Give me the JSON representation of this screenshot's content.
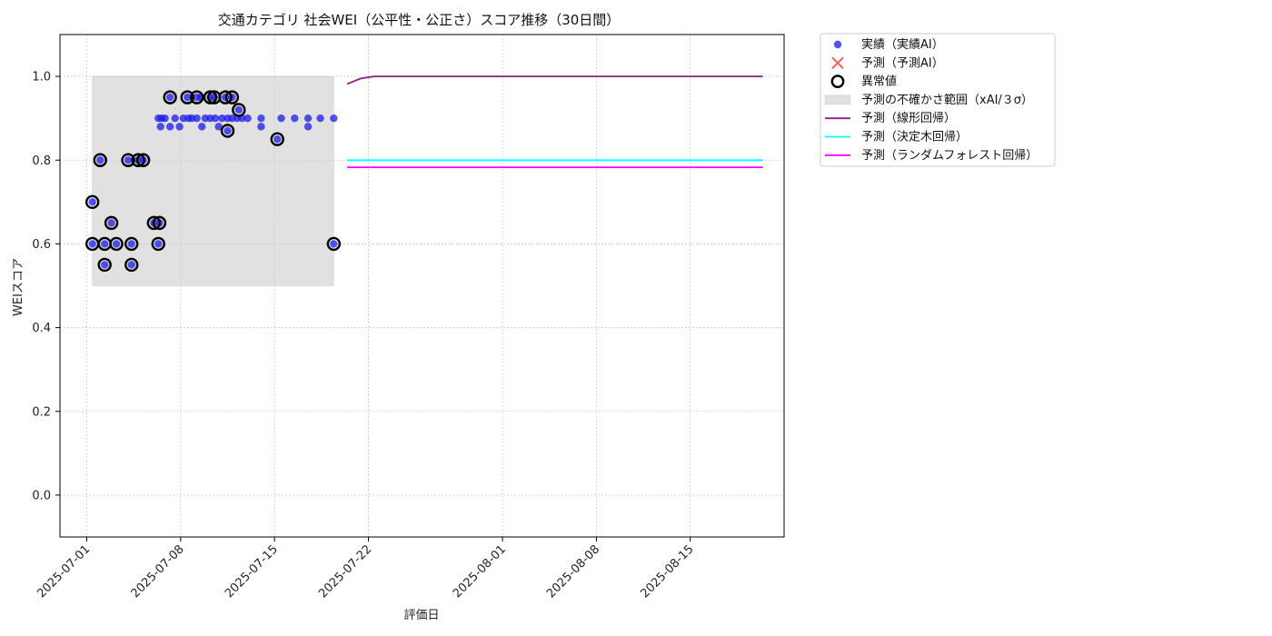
{
  "chart_data": {
    "type": "scatter",
    "title": "交通カテゴリ 社会WEI（公平性・公正さ）スコア推移（30日間）",
    "xlabel": "評価日",
    "ylabel": "WEIスコア",
    "xlim": [
      "2025-06-29",
      "2025-08-22"
    ],
    "ylim": [
      -0.1,
      1.1
    ],
    "grid": true,
    "legend_position": "outside-top-right",
    "x_ticks": [
      "2025-07-01",
      "2025-07-08",
      "2025-07-15",
      "2025-07-22",
      "2025-08-01",
      "2025-08-08",
      "2025-08-15"
    ],
    "y_ticks": [
      "0.0",
      "0.2",
      "0.4",
      "0.6",
      "0.8",
      "1.0"
    ],
    "colors": {
      "actual": "#1a1aee",
      "anomaly_edge": "#000000",
      "band": "#d9d9d9",
      "linear": "#8b1f8b",
      "tree": "#00ffff",
      "forest": "#ff00ff",
      "predicted_marker": "#ff3b3b"
    },
    "legend": [
      {
        "kind": "actual",
        "label": "実績（実績AI）"
      },
      {
        "kind": "predicted",
        "label": "予測（予測AI）"
      },
      {
        "kind": "anomaly",
        "label": "異常値"
      },
      {
        "kind": "band",
        "label": "予測の不確かさ範囲（xAI/３σ）"
      },
      {
        "kind": "linear",
        "label": "予測（線形回帰）"
      },
      {
        "kind": "tree",
        "label": "予測（決定木回帰）"
      },
      {
        "kind": "forest",
        "label": "予測（ランダムフォレスト回帰）"
      }
    ],
    "uncertainty_band": {
      "x_start": "2025-07-01T10:00",
      "x_end": "2025-07-19T10:00",
      "y_low": 0.5,
      "y_high": 1.0
    },
    "series": [
      {
        "name": "実績（実績AI）",
        "kind": "actual",
        "points": [
          [
            "2025-07-01T10:00",
            0.6
          ],
          [
            "2025-07-01T10:00",
            0.7
          ],
          [
            "2025-07-02T00:00",
            0.8
          ],
          [
            "2025-07-02T08:00",
            0.6
          ],
          [
            "2025-07-02T08:00",
            0.55
          ],
          [
            "2025-07-02T20:00",
            0.65
          ],
          [
            "2025-07-03T05:00",
            0.6
          ],
          [
            "2025-07-04T02:00",
            0.8
          ],
          [
            "2025-07-04T08:00",
            0.6
          ],
          [
            "2025-07-04T08:00",
            0.55
          ],
          [
            "2025-07-04T20:00",
            0.8
          ],
          [
            "2025-07-05T05:00",
            0.8
          ],
          [
            "2025-07-06T00:00",
            0.65
          ],
          [
            "2025-07-06T10:00",
            0.65
          ],
          [
            "2025-07-06T08:00",
            0.6
          ],
          [
            "2025-07-06T08:00",
            0.9
          ],
          [
            "2025-07-06T12:00",
            0.88
          ],
          [
            "2025-07-06T14:00",
            0.9
          ],
          [
            "2025-07-06T20:00",
            0.9
          ],
          [
            "2025-07-07T05:00",
            0.95
          ],
          [
            "2025-07-07T05:00",
            0.88
          ],
          [
            "2025-07-07T14:00",
            0.9
          ],
          [
            "2025-07-07T22:00",
            0.88
          ],
          [
            "2025-07-08T05:00",
            0.9
          ],
          [
            "2025-07-08T12:00",
            0.95
          ],
          [
            "2025-07-08T14:00",
            0.9
          ],
          [
            "2025-07-08T20:00",
            0.9
          ],
          [
            "2025-07-09T05:00",
            0.95
          ],
          [
            "2025-07-09T05:00",
            0.9
          ],
          [
            "2025-07-09T12:00",
            0.95
          ],
          [
            "2025-07-09T14:00",
            0.88
          ],
          [
            "2025-07-09T20:00",
            0.9
          ],
          [
            "2025-07-10T05:00",
            0.95
          ],
          [
            "2025-07-10T05:00",
            0.9
          ],
          [
            "2025-07-10T12:00",
            0.95
          ],
          [
            "2025-07-10T14:00",
            0.9
          ],
          [
            "2025-07-10T20:00",
            0.88
          ],
          [
            "2025-07-11T02:00",
            0.9
          ],
          [
            "2025-07-11T08:00",
            0.95
          ],
          [
            "2025-07-11T12:00",
            0.87
          ],
          [
            "2025-07-11T12:00",
            0.9
          ],
          [
            "2025-07-11T20:00",
            0.95
          ],
          [
            "2025-07-11T20:00",
            0.9
          ],
          [
            "2025-07-12T05:00",
            0.9
          ],
          [
            "2025-07-12T08:00",
            0.92
          ],
          [
            "2025-07-12T14:00",
            0.9
          ],
          [
            "2025-07-13T00:00",
            0.9
          ],
          [
            "2025-07-14T00:00",
            0.9
          ],
          [
            "2025-07-14T00:00",
            0.88
          ],
          [
            "2025-07-15T05:00",
            0.85
          ],
          [
            "2025-07-15T12:00",
            0.9
          ],
          [
            "2025-07-16T12:00",
            0.9
          ],
          [
            "2025-07-17T12:00",
            0.9
          ],
          [
            "2025-07-17T12:00",
            0.88
          ],
          [
            "2025-07-18T10:00",
            0.9
          ],
          [
            "2025-07-19T10:00",
            0.9
          ],
          [
            "2025-07-19T10:00",
            0.6
          ]
        ]
      },
      {
        "name": "異常値",
        "kind": "anomaly",
        "points": [
          [
            "2025-07-01T10:00",
            0.6
          ],
          [
            "2025-07-01T10:00",
            0.7
          ],
          [
            "2025-07-02T00:00",
            0.8
          ],
          [
            "2025-07-02T08:00",
            0.6
          ],
          [
            "2025-07-02T08:00",
            0.55
          ],
          [
            "2025-07-02T20:00",
            0.65
          ],
          [
            "2025-07-03T05:00",
            0.6
          ],
          [
            "2025-07-04T02:00",
            0.8
          ],
          [
            "2025-07-04T08:00",
            0.6
          ],
          [
            "2025-07-04T08:00",
            0.55
          ],
          [
            "2025-07-04T20:00",
            0.8
          ],
          [
            "2025-07-05T05:00",
            0.8
          ],
          [
            "2025-07-06T00:00",
            0.65
          ],
          [
            "2025-07-06T10:00",
            0.65
          ],
          [
            "2025-07-06T08:00",
            0.6
          ],
          [
            "2025-07-07T05:00",
            0.95
          ],
          [
            "2025-07-08T12:00",
            0.95
          ],
          [
            "2025-07-09T05:00",
            0.95
          ],
          [
            "2025-07-10T05:00",
            0.95
          ],
          [
            "2025-07-10T12:00",
            0.95
          ],
          [
            "2025-07-11T08:00",
            0.95
          ],
          [
            "2025-07-11T12:00",
            0.87
          ],
          [
            "2025-07-11T20:00",
            0.95
          ],
          [
            "2025-07-12T08:00",
            0.92
          ],
          [
            "2025-07-15T05:00",
            0.85
          ],
          [
            "2025-07-19T10:00",
            0.6
          ]
        ]
      },
      {
        "name": "予測（線形回帰）",
        "kind": "linear",
        "points": [
          [
            "2025-07-20T10:00",
            0.982
          ],
          [
            "2025-07-21T10:00",
            0.995
          ],
          [
            "2025-07-22T10:00",
            1.0
          ],
          [
            "2025-08-20T10:00",
            1.0
          ]
        ]
      },
      {
        "name": "予測（決定木回帰）",
        "kind": "tree",
        "points": [
          [
            "2025-07-20T10:00",
            0.8
          ],
          [
            "2025-08-20T10:00",
            0.8
          ]
        ]
      },
      {
        "name": "予測（ランダムフォレスト回帰）",
        "kind": "forest",
        "points": [
          [
            "2025-07-20T10:00",
            0.783
          ],
          [
            "2025-08-20T10:00",
            0.783
          ]
        ]
      }
    ]
  }
}
